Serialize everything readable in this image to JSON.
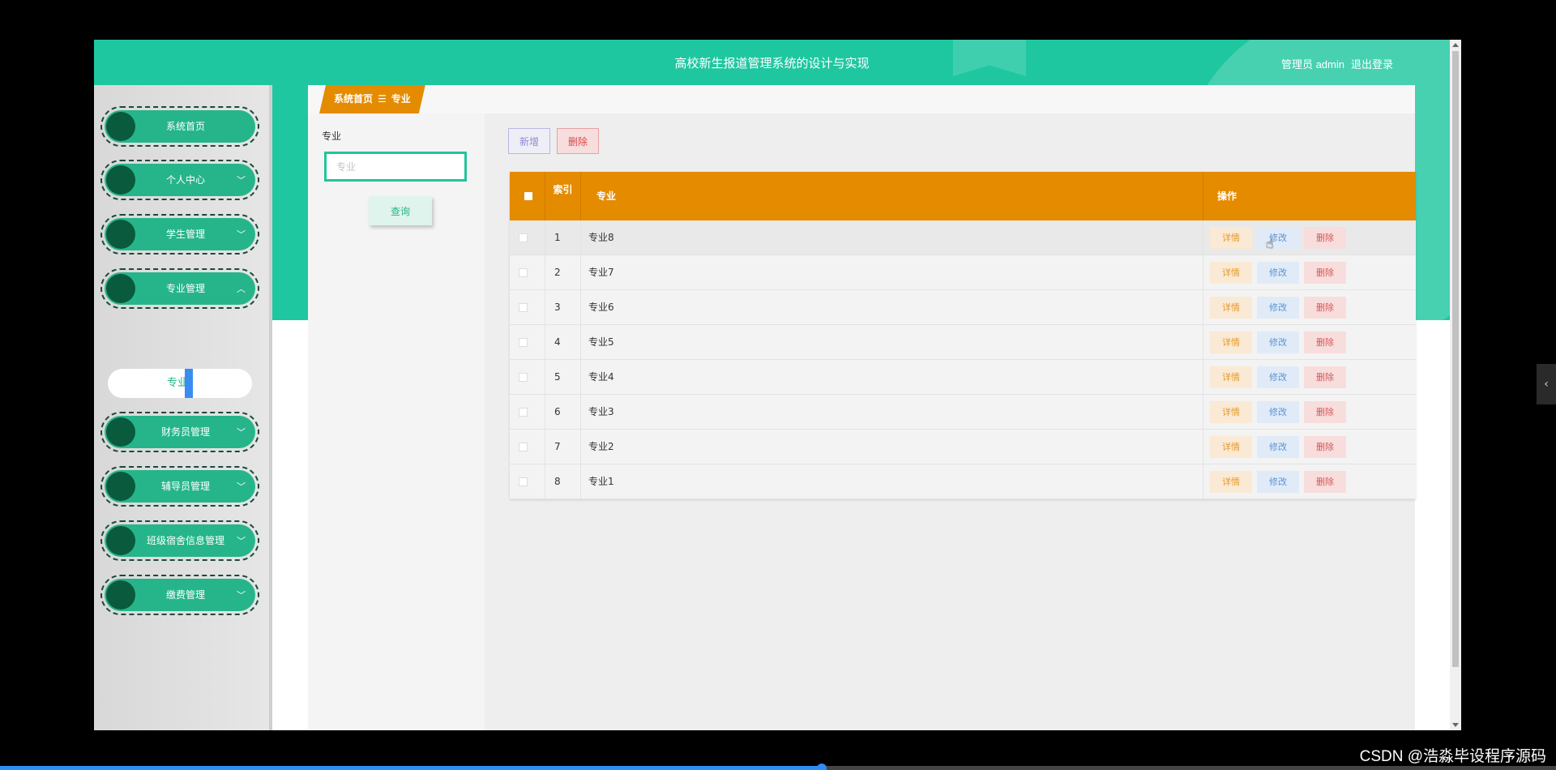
{
  "header": {
    "title": "高校新生报道管理系统的设计与实现",
    "user_label": "管理员 admin",
    "logout": "退出登录"
  },
  "sidebar": {
    "items": [
      {
        "label": "系统首页",
        "chevron": ""
      },
      {
        "label": "个人中心",
        "chevron": "﹀"
      },
      {
        "label": "学生管理",
        "chevron": "﹀"
      },
      {
        "label": "专业管理",
        "chevron": "︿"
      },
      {
        "label": "财务员管理",
        "chevron": "﹀"
      },
      {
        "label": "辅导员管理",
        "chevron": "﹀"
      },
      {
        "label": "班级宿舍信息管理",
        "chevron": "﹀"
      },
      {
        "label": "缴费管理",
        "chevron": "﹀"
      }
    ],
    "submenu_active": "专业"
  },
  "breadcrumb": {
    "home": "系统首页",
    "sep": "☰",
    "current": "专业"
  },
  "search": {
    "label": "专业",
    "placeholder": "专业",
    "query_button": "查询"
  },
  "toolbar": {
    "add": "新增",
    "delete": "删除"
  },
  "table": {
    "headers": {
      "index": "索引",
      "major": "专业",
      "ops": "操作"
    },
    "rows": [
      {
        "index": "1",
        "major": "专业8"
      },
      {
        "index": "2",
        "major": "专业7"
      },
      {
        "index": "3",
        "major": "专业6"
      },
      {
        "index": "4",
        "major": "专业5"
      },
      {
        "index": "5",
        "major": "专业4"
      },
      {
        "index": "6",
        "major": "专业3"
      },
      {
        "index": "7",
        "major": "专业2"
      },
      {
        "index": "8",
        "major": "专业1"
      }
    ],
    "row_actions": {
      "detail": "详情",
      "edit": "修改",
      "delete": "删除"
    }
  },
  "overlay": {
    "watermark": "CSDN @浩淼毕设程序源码",
    "side_tab": "‹",
    "cursor": "☝"
  },
  "colors": {
    "header_green": "#1fc7a0",
    "table_header_orange": "#e48b00",
    "menu_green": "#26b58a",
    "menu_dot": "#0a5a3e"
  },
  "video_progress": 0.528
}
